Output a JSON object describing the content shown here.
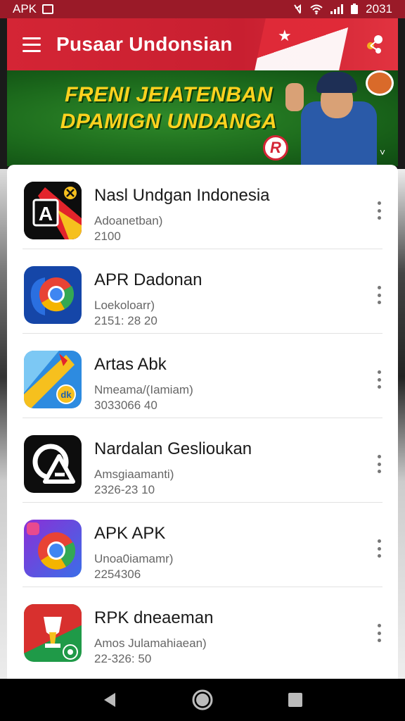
{
  "status_bar": {
    "left_text": "APK",
    "right_text": "2031",
    "icons": [
      "image-icon",
      "mute-icon",
      "wifi-icon",
      "signal-icon",
      "battery-icon"
    ]
  },
  "header": {
    "title": "Pusaar Undonsian",
    "icons": [
      "hamburger-menu-icon",
      "share-icon"
    ]
  },
  "banner": {
    "line1": "FRENI JEIATENBAN",
    "line2": "DPAMIGN UNDANGA",
    "logo_letter": "R",
    "chevron": "˅"
  },
  "apps": [
    {
      "name": "Nasl Undgan Indonesia",
      "subtitle": "Adoanetban)",
      "number": "2100",
      "icon": "black-red-yellow-a-logo-icon",
      "icon_letter": "A"
    },
    {
      "name": "APR Dadonan",
      "subtitle": "Loekoloarr)",
      "number": "2151: 28 20",
      "icon": "blue-chrome-style-icon"
    },
    {
      "name": "Artas Abk",
      "subtitle": "Nmeama/(Iamiam)",
      "number": "3033066 40",
      "icon": "yellow-blue-maps-style-icon",
      "icon_letter": "dk"
    },
    {
      "name": "Nardalan Geslioukan",
      "subtitle": "Amsgiaamanti)",
      "number": "2326-23 10",
      "icon": "black-white-circle-a-icon"
    },
    {
      "name": "APK APK",
      "subtitle": "Unoa0iamamr)",
      "number": "2254306",
      "icon": "purple-chrome-style-icon"
    },
    {
      "name": "RPK dneaeman",
      "subtitle": "Amos Julamahiaean)",
      "number": "22-326: 50",
      "icon": "green-red-trophy-icon"
    }
  ],
  "nav": {
    "icons": [
      "back-triangle-icon",
      "home-circle-icon",
      "recents-square-icon"
    ]
  }
}
